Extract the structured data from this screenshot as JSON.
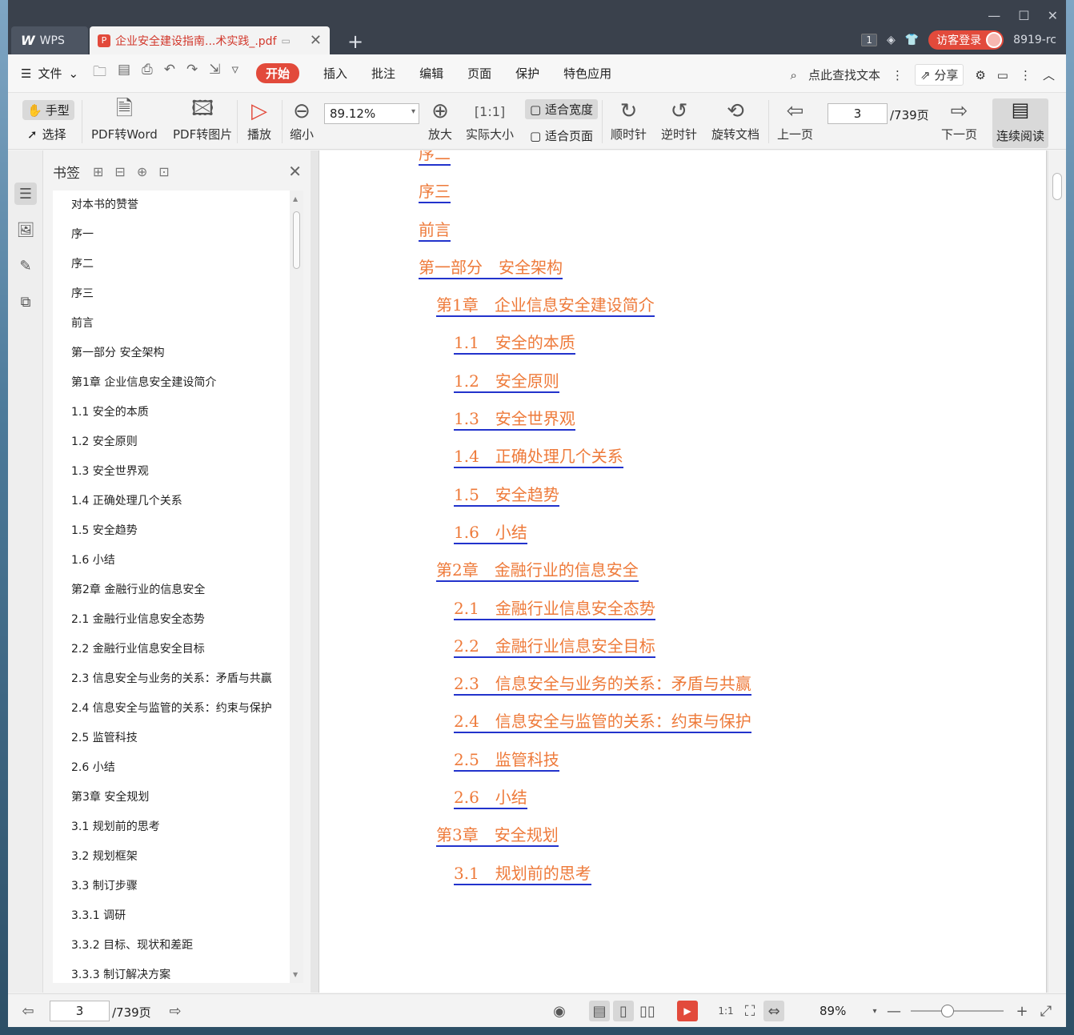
{
  "titlebar": {
    "app_tab": "WPS",
    "doc_tab": "企业安全建设指南...术实践_.pdf",
    "badge": "1",
    "login": "访客登录",
    "version": "8919-rc"
  },
  "menubar": {
    "file": "文件",
    "tabs": [
      "开始",
      "插入",
      "批注",
      "编辑",
      "页面",
      "保护",
      "特色应用"
    ],
    "active_tab": "开始",
    "search": "点此查找文本",
    "share": "分享"
  },
  "ribbon": {
    "hand": "手型",
    "select": "选择",
    "pdf_to_word": "PDF转Word",
    "pdf_to_image": "PDF转图片",
    "play": "播放",
    "zoom_out": "缩小",
    "zoom_value": "89.12%",
    "zoom_in": "放大",
    "actual_size": "实际大小",
    "fit_width": "适合宽度",
    "fit_page": "适合页面",
    "rotate_cw": "顺时针",
    "rotate_ccw": "逆时针",
    "rotate_doc": "旋转文档",
    "prev_page": "上一页",
    "page_value": "3",
    "page_total": "/739页",
    "next_page": "下一页",
    "continuous": "连续阅读"
  },
  "bookmarks": {
    "title": "书签",
    "items": [
      "对本书的赞誉",
      "序一",
      "序二",
      "序三",
      "前言",
      "第一部分 安全架构",
      "第1章 企业信息安全建设简介",
      "1.1 安全的本质",
      "1.2 安全原则",
      "1.3 安全世界观",
      "1.4 正确处理几个关系",
      "1.5 安全趋势",
      "1.6 小结",
      "第2章 金融行业的信息安全",
      "2.1 金融行业信息安全态势",
      "2.2 金融行业信息安全目标",
      "2.3 信息安全与业务的关系：矛盾与共赢",
      "2.4 信息安全与监管的关系：约束与保护",
      "2.5 监管科技",
      "2.6 小结",
      "第3章 安全规划",
      "3.1 规划前的思考",
      "3.2 规划框架",
      "3.3 制订步骤",
      "3.3.1 调研",
      "3.3.2 目标、现状和差距",
      "3.3.3 制订解决方案"
    ]
  },
  "document": {
    "toc": [
      {
        "text": "序二",
        "level": 1
      },
      {
        "text": "序三",
        "level": 1
      },
      {
        "text": "前言",
        "level": 1
      },
      {
        "text": "第一部分　安全架构",
        "level": 1
      },
      {
        "text": "第1章　企业信息安全建设简介",
        "level": 2
      },
      {
        "text": "1.1　安全的本质",
        "level": 3
      },
      {
        "text": "1.2　安全原则",
        "level": 3
      },
      {
        "text": "1.3　安全世界观",
        "level": 3
      },
      {
        "text": "1.4　正确处理几个关系",
        "level": 3
      },
      {
        "text": "1.5　安全趋势",
        "level": 3
      },
      {
        "text": "1.6　小结",
        "level": 3
      },
      {
        "text": "第2章　金融行业的信息安全",
        "level": 2
      },
      {
        "text": "2.1　金融行业信息安全态势",
        "level": 3
      },
      {
        "text": "2.2　金融行业信息安全目标",
        "level": 3
      },
      {
        "text": "2.3　信息安全与业务的关系：矛盾与共赢",
        "level": 3
      },
      {
        "text": "2.4　信息安全与监管的关系：约束与保护",
        "level": 3
      },
      {
        "text": "2.5　监管科技",
        "level": 3
      },
      {
        "text": "2.6　小结",
        "level": 3
      },
      {
        "text": "第3章　安全规划",
        "level": 2
      },
      {
        "text": "3.1　规划前的思考",
        "level": 3
      }
    ]
  },
  "statusbar": {
    "page_value": "3",
    "page_total": "/739页",
    "zoom": "89%",
    "zoom_slider_fraction": 0.4
  },
  "colors": {
    "accent": "#e24a3b",
    "toc_text": "#ee7a3a",
    "toc_underline": "#2233cc"
  }
}
